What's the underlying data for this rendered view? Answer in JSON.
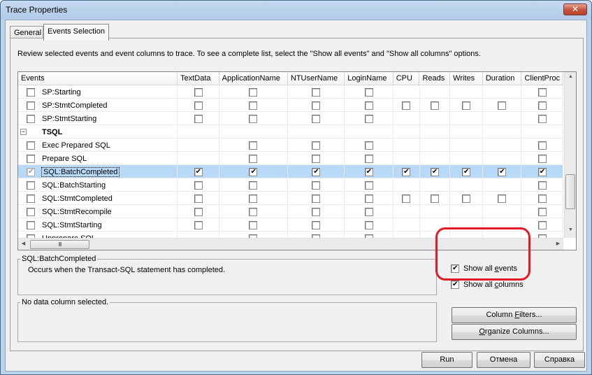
{
  "window": {
    "title": "Trace Properties",
    "close_icon": "close-x-icon"
  },
  "tabs": [
    {
      "label": "General",
      "active": false
    },
    {
      "label": "Events Selection",
      "active": true
    }
  ],
  "intro_text": "Review selected events and event columns to trace. To see a complete list, select the \"Show all events\" and \"Show all columns\" options.",
  "grid": {
    "columns": [
      "Events",
      "TextData",
      "ApplicationName",
      "NTUserName",
      "LoginName",
      "CPU",
      "Reads",
      "Writes",
      "Duration",
      "ClientProc"
    ],
    "rows": [
      {
        "type": "event",
        "name": "SP:Starting",
        "checked": false,
        "cells": [
          "0",
          "0",
          "0",
          "0",
          "",
          "",
          "",
          "",
          "0"
        ]
      },
      {
        "type": "event",
        "name": "SP:StmtCompleted",
        "checked": false,
        "cells": [
          "0",
          "0",
          "0",
          "0",
          "0",
          "0",
          "0",
          "0",
          "0"
        ]
      },
      {
        "type": "event",
        "name": "SP:StmtStarting",
        "checked": false,
        "cells": [
          "0",
          "0",
          "0",
          "0",
          "",
          "",
          "",
          "",
          "0"
        ]
      },
      {
        "type": "category",
        "name": "TSQL",
        "expanded": true,
        "cells": [
          "",
          "",
          "",
          "",
          "",
          "",
          "",
          "",
          ""
        ]
      },
      {
        "type": "event",
        "name": "Exec Prepared SQL",
        "checked": false,
        "cells": [
          "",
          "0",
          "0",
          "0",
          "",
          "",
          "",
          "",
          "0"
        ]
      },
      {
        "type": "event",
        "name": "Prepare SQL",
        "checked": false,
        "cells": [
          "",
          "0",
          "0",
          "0",
          "",
          "",
          "",
          "",
          "0"
        ]
      },
      {
        "type": "event",
        "name": "SQL:BatchCompleted",
        "checked": true,
        "selected": true,
        "cells": [
          "1",
          "1",
          "1",
          "1",
          "1",
          "1",
          "1",
          "1",
          "1"
        ]
      },
      {
        "type": "event",
        "name": "SQL:BatchStarting",
        "checked": false,
        "cells": [
          "0",
          "0",
          "0",
          "0",
          "",
          "",
          "",
          "",
          "0"
        ]
      },
      {
        "type": "event",
        "name": "SQL:StmtCompleted",
        "checked": false,
        "cells": [
          "0",
          "0",
          "0",
          "0",
          "0",
          "0",
          "0",
          "0",
          "0"
        ]
      },
      {
        "type": "event",
        "name": "SQL:StmtRecompile",
        "checked": false,
        "cells": [
          "0",
          "0",
          "0",
          "0",
          "",
          "",
          "",
          "",
          "0"
        ]
      },
      {
        "type": "event",
        "name": "SQL:StmtStarting",
        "checked": false,
        "cells": [
          "0",
          "0",
          "0",
          "0",
          "",
          "",
          "",
          "",
          "0"
        ]
      },
      {
        "type": "event",
        "name": "Unprepare SQL",
        "checked": false,
        "cells": [
          "",
          "0",
          "0",
          "0",
          "",
          "",
          "",
          "",
          "0"
        ]
      }
    ],
    "hscroll_grip": "III"
  },
  "event_description": {
    "title": "SQL:BatchCompleted",
    "text": "Occurs when the Transact-SQL statement has completed."
  },
  "column_description": {
    "title": "No data column selected."
  },
  "options": {
    "show_all_events": {
      "pre": "Show all ",
      "key": "e",
      "post": "vents",
      "checked": true
    },
    "show_all_columns": {
      "pre": "Show all ",
      "key": "c",
      "post": "olumns",
      "checked": true
    }
  },
  "buttons": {
    "column_filters": {
      "pre": "Column ",
      "key": "F",
      "post": "ilters..."
    },
    "organize_columns": {
      "pre": "",
      "key": "O",
      "post": "rganize Columns..."
    },
    "run": "Run",
    "cancel": "Отмена",
    "help": "Справка"
  },
  "annotation_color": "#e21b25"
}
